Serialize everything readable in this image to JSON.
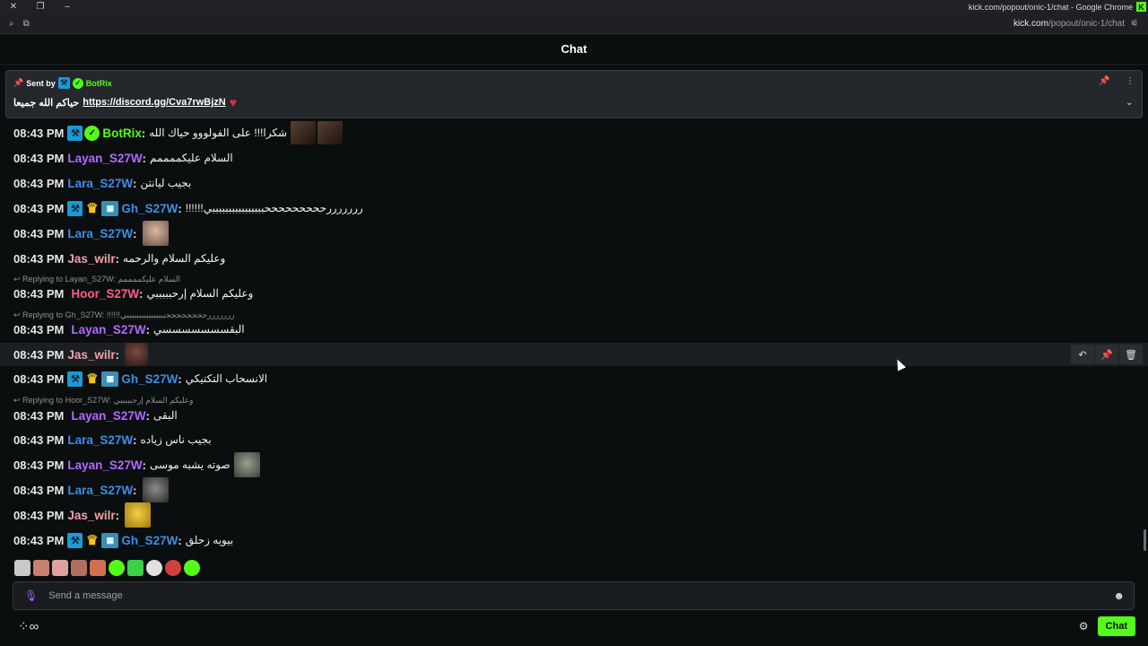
{
  "window": {
    "title": "kick.com/popout/onic-1/chat - Google Chrome",
    "url_domain": "kick.com",
    "url_path": "/popout/onic-1/chat"
  },
  "header": {
    "title": "Chat"
  },
  "pinned": {
    "sent_by_label": "Sent by",
    "sender": "BotRix",
    "prefix": "حياكم الله جميعا",
    "link": "https://discord.gg/Cva7rwBjzN"
  },
  "messages": [
    {
      "time": "08:43 PM",
      "user": "BotRix",
      "text": "شكرا!!! على الفولووو حياك الله"
    },
    {
      "time": "08:43 PM",
      "user": "Layan_S27W",
      "text": "السلام عليكممممم"
    },
    {
      "time": "08:43 PM",
      "user": "Lara_S27W",
      "text": "بجيب ليانتن"
    },
    {
      "time": "08:43 PM",
      "user": "Gh_S27W",
      "text": "!!!!!!رررررررحححححححححببببببببببببببببي"
    },
    {
      "time": "08:43 PM",
      "user": "Lara_S27W",
      "text": ""
    },
    {
      "time": "08:43 PM",
      "user": "Jas_wilr",
      "text": "وعليكم السلام والرحمه"
    },
    {
      "reply": "Replying to Layan_S27W: السلام عليكممممم"
    },
    {
      "time": "08:43 PM",
      "user": "Hoor_S27W",
      "text": "وعليكم السلام إرحبببببي"
    },
    {
      "reply": "Replying to Gh_S27W: !!!!!!رررررررححححححححببببببببببببببببي"
    },
    {
      "time": "08:43 PM",
      "user": "Layan_S27W",
      "text": "البقسسسسسسسي"
    },
    {
      "time": "08:43 PM",
      "user": "Jas_wilr",
      "text": ""
    },
    {
      "time": "08:43 PM",
      "user": "Gh_S27W",
      "text": "الانسحاب التكتيكي"
    },
    {
      "reply": "Replying to Hoor_S27W: وعليكم السلام إرحبببببي"
    },
    {
      "time": "08:43 PM",
      "user": "Layan_S27W",
      "text": "البقى"
    },
    {
      "time": "08:43 PM",
      "user": "Lara_S27W",
      "text": "بجيب ناس زياده"
    },
    {
      "time": "08:43 PM",
      "user": "Layan_S27W",
      "text": "صوته يشبه موسى"
    },
    {
      "time": "08:43 PM",
      "user": "Lara_S27W",
      "text": ""
    },
    {
      "time": "08:43 PM",
      "user": "Jas_wilr",
      "text": ""
    },
    {
      "time": "08:43 PM",
      "user": "Gh_S27W",
      "text": "بيويه زحلق"
    }
  ],
  "colors": {
    "green": "#53fc18",
    "purple": "#b368ff",
    "blue": "#3d8ee6",
    "pink": "#f0a0a8",
    "red": "#ff5f7e"
  },
  "input": {
    "placeholder": "Send a message"
  },
  "footer": {
    "chat_button": "Chat"
  }
}
